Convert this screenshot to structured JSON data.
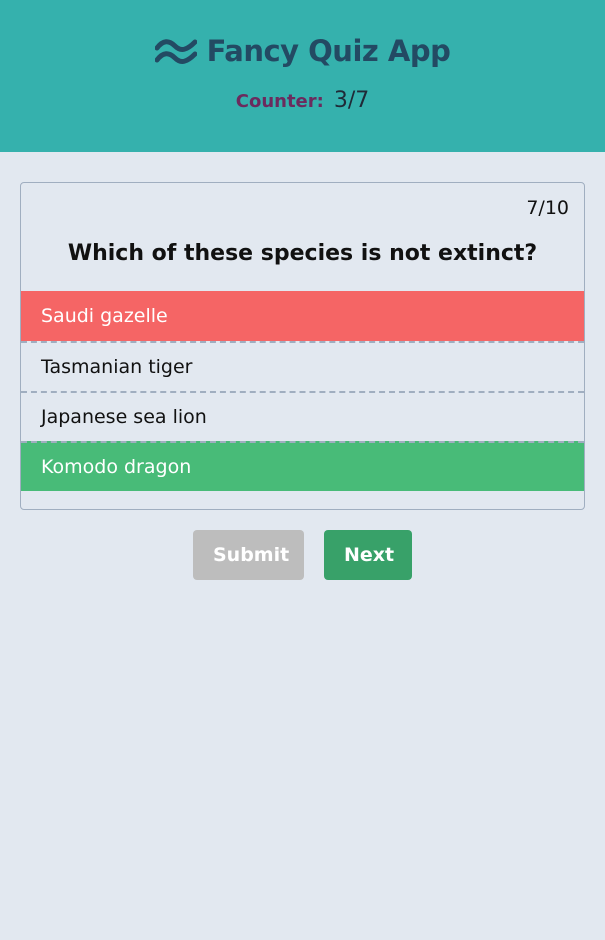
{
  "header": {
    "app_title": "Fancy Quiz App",
    "logo_icon": "wave-logo-icon",
    "counter_label": "Counter:",
    "counter_value": "3/7",
    "background_color": "#35b1ad"
  },
  "quiz": {
    "progress": "7/10",
    "question": "Which of these species is not extinct?",
    "answers": [
      {
        "label": "Saudi gazelle",
        "state": "wrong"
      },
      {
        "label": "Tasmanian tiger",
        "state": "neutral"
      },
      {
        "label": "Japanese sea lion",
        "state": "neutral"
      },
      {
        "label": "Komodo dragon",
        "state": "correct"
      }
    ],
    "colors": {
      "wrong": "#f56565",
      "correct": "#48bb78"
    }
  },
  "actions": {
    "submit_label": "Submit",
    "next_label": "Next"
  }
}
